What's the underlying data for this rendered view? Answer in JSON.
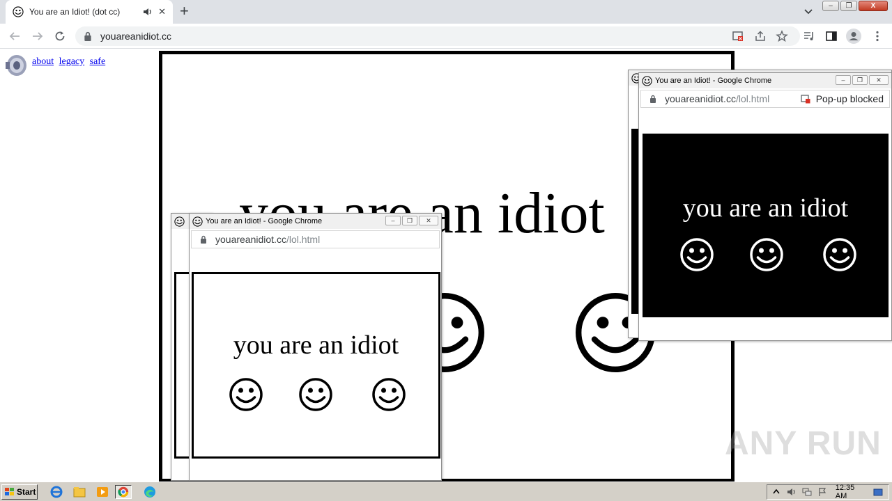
{
  "browser": {
    "tab_title": "You are an Idiot! (dot cc)",
    "tab_close": "✕",
    "new_tab": "+",
    "url": "youareanidiot.cc",
    "window_controls": {
      "minimize": "–",
      "restore": "❐",
      "close": "X"
    }
  },
  "page": {
    "links": [
      {
        "label": "about"
      },
      {
        "label": "legacy"
      },
      {
        "label": "safe"
      }
    ],
    "big_text": "you are an idiot"
  },
  "popups": [
    {
      "title": "You are an Idiot! - Google Chrome",
      "url_host": "youareanidiot.cc",
      "url_path": "/lol.html",
      "text": "you are an idiot",
      "theme": "white"
    },
    {
      "title": "You are an Idiot! - Google Chrome",
      "url_host": "youareanidiot.cc",
      "url_path": "/lol.html",
      "blocked_label": "Pop-up blocked",
      "text": "you are an idiot",
      "theme": "black"
    }
  ],
  "watermark": "ANY RUN",
  "taskbar": {
    "start_label": "Start",
    "clock": "12:35 AM",
    "apps": [
      "ie-icon",
      "explorer-icon",
      "media-player-icon",
      "chrome-icon",
      "edge-icon"
    ]
  },
  "colors": {
    "tabstrip": "#dee1e6",
    "omnibox": "#f1f3f4",
    "taskbar": "#d4d0c8",
    "link": "#0000ee"
  }
}
